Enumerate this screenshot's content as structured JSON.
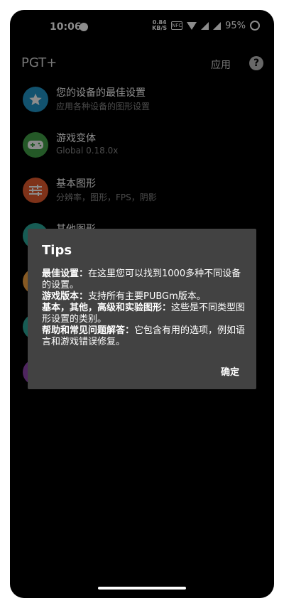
{
  "status_bar": {
    "time": "10:06",
    "speed_value": "0.84",
    "speed_unit": "KB/S",
    "nfc_label": "NFC",
    "battery": "95%"
  },
  "app_bar": {
    "title": "PGT+",
    "apply_label": "应用",
    "help_icon": "?"
  },
  "list_items": [
    {
      "title": "您的设备的最佳设置",
      "subtitle": "应用各种设备的图形设置",
      "icon": "star-icon",
      "color": "#2196c9"
    },
    {
      "title": "游戏变体",
      "subtitle": "Global 0.18.0x",
      "icon": "gamepad-icon",
      "color": "#43a047"
    },
    {
      "title": "基本图形",
      "subtitle": "分辨率，图形，FPS，阴影",
      "icon": "sliders-icon",
      "color": "#e55b2e"
    },
    {
      "title": "其他图形",
      "subtitle": "",
      "icon": "tune-icon",
      "color": "#2aa89a"
    },
    {
      "title": "",
      "subtitle": "",
      "icon": "advanced-icon",
      "color": "#f4a340"
    },
    {
      "title": "",
      "subtitle": "",
      "icon": "experimental-icon",
      "color": "#2aa89a"
    },
    {
      "title": "",
      "subtitle": "",
      "icon": "faq-icon",
      "color": "#8e44ad"
    }
  ],
  "dialog": {
    "title": "Tips",
    "paragraphs": [
      {
        "bold": "最佳设置：",
        "text": "在这里您可以找到1000多种不同设备的设置。"
      },
      {
        "bold": "游戏版本：",
        "text": "支持所有主要PUBGm版本。"
      },
      {
        "bold": "基本，其他，高级和实验图形：",
        "text": "这些是不同类型图形设置的类别。"
      },
      {
        "bold": "帮助和常见问题解答：",
        "text": "它包含有用的选项，例如语言和游戏错误修复。"
      }
    ],
    "ok_label": "确定"
  }
}
